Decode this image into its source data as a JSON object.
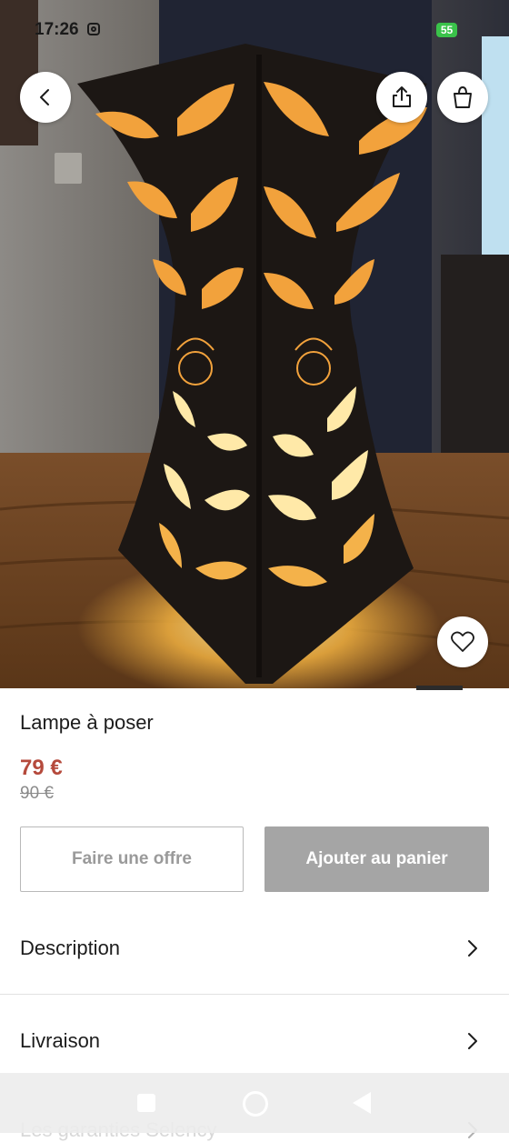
{
  "status_bar": {
    "time": "17:26",
    "battery": "55"
  },
  "icons": {
    "back": "chevron-left-icon",
    "share": "share-icon",
    "bag": "shopping-bag-icon",
    "favorite": "heart-icon",
    "chevron": "chevron-right-icon"
  },
  "product": {
    "title": "Lampe à poser",
    "price": "79 €",
    "old_price": "90 €",
    "image_index": 1
  },
  "actions": {
    "offer_label": "Faire une offre",
    "cart_label": "Ajouter au panier"
  },
  "sections": [
    {
      "label": "Description"
    },
    {
      "label": "Livraison"
    },
    {
      "label": "Les garanties Selency"
    }
  ],
  "colors": {
    "price": "#b54a3c",
    "cart_button": "#a5a5a5",
    "battery": "#3ac24a"
  }
}
